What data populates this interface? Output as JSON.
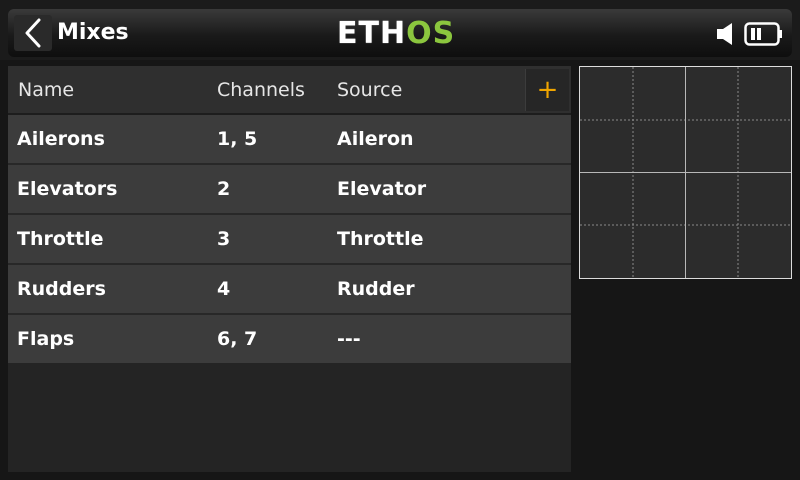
{
  "header": {
    "title": "Mixes",
    "logo_part1": "ETH",
    "logo_part2": "OS",
    "logo_accent_color": "#8bc63e",
    "back_icon": "chevron-left-icon",
    "speaker_icon": "speaker-icon",
    "battery_icon": "battery-icon"
  },
  "table": {
    "columns": [
      "Name",
      "Channels",
      "Source"
    ],
    "add_label": "+",
    "add_color": "#f0a500",
    "rows": [
      {
        "name": "Ailerons",
        "channels": "1, 5",
        "source": "Aileron"
      },
      {
        "name": "Elevators",
        "channels": "2",
        "source": "Elevator"
      },
      {
        "name": "Throttle",
        "channels": "3",
        "source": "Throttle"
      },
      {
        "name": "Rudders",
        "channels": "4",
        "source": "Rudder"
      },
      {
        "name": "Flaps",
        "channels": "6, 7",
        "source": "---"
      }
    ]
  }
}
